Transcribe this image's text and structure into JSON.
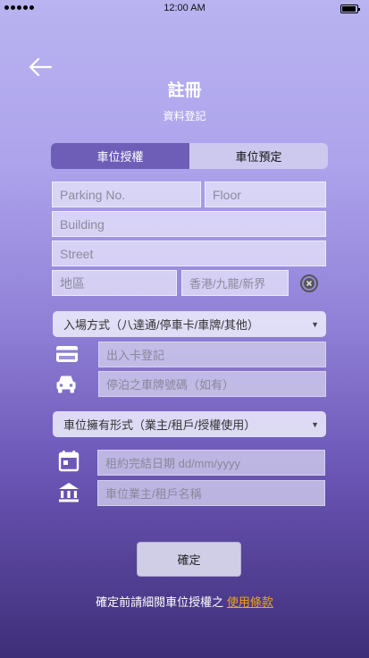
{
  "status_bar": {
    "time": "12:00 AM"
  },
  "header": {
    "title": "註冊",
    "subtitle": "資料登記",
    "back_icon": "arrow-left-icon"
  },
  "tabs": [
    {
      "label": "車位授權",
      "active": true
    },
    {
      "label": "車位預定",
      "active": false
    }
  ],
  "address": {
    "parking_no_placeholder": "Parking No.",
    "floor_placeholder": "Floor",
    "building_placeholder": "Building",
    "street_placeholder": "Street",
    "district_placeholder": "地區",
    "region_placeholder": "香港/九龍/新界"
  },
  "entry": {
    "method_select": "入場方式（八達通/停車卡/車牌/其他）",
    "card_placeholder": "出入卡登記",
    "plate_placeholder": "停泊之車牌號碼（如有）"
  },
  "ownership": {
    "form_select": "車位擁有形式（業主/租戶/授權使用）",
    "lease_end_placeholder": "租約完結日期 dd/mm/yyyy",
    "owner_name_placeholder": "車位業主/租戶名稱"
  },
  "confirm_label": "確定",
  "terms": {
    "prefix": "確定前請細閱車位授權之",
    "link": "使用條款"
  },
  "colors": {
    "active_tab": "#6e5eb8",
    "link": "#f0a020"
  }
}
